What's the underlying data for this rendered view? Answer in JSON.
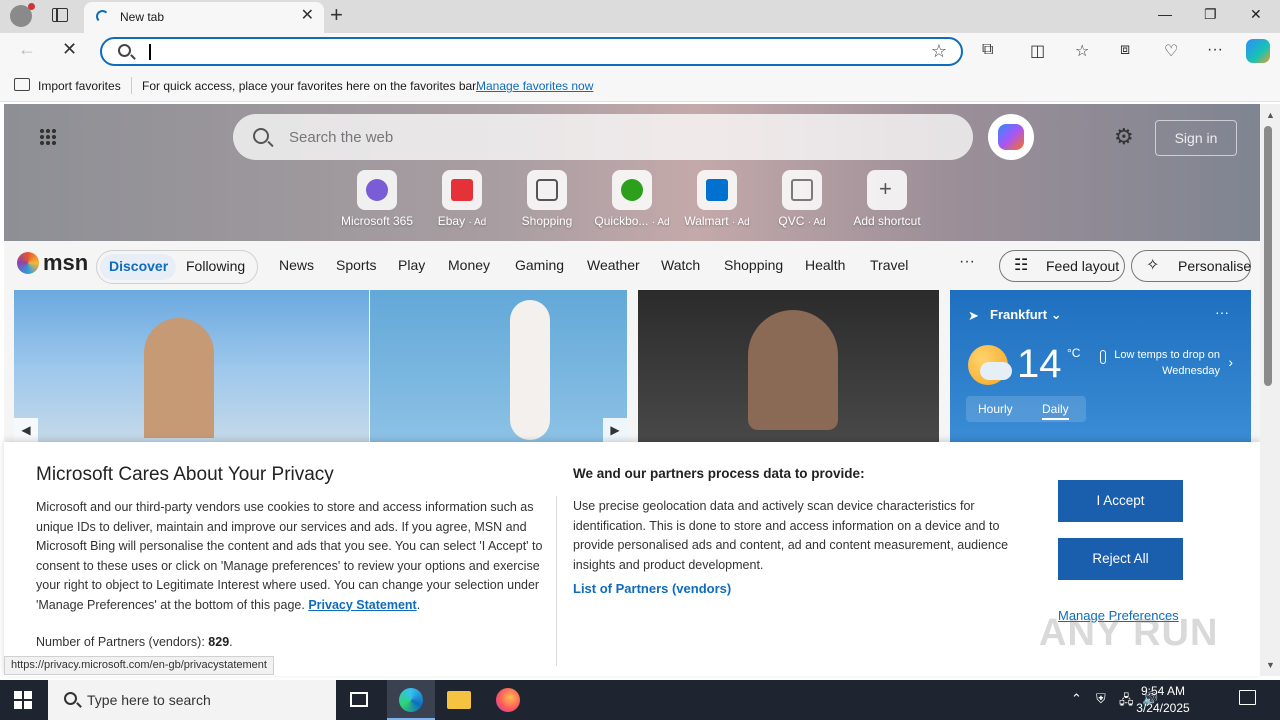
{
  "browser": {
    "tab_title": "New tab",
    "address_value": "",
    "favorites_import": "Import favorites",
    "favorites_hint": "For quick access, place your favorites here on the favorites bar.",
    "favorites_link": "Manage favorites now",
    "accent_color": "#0f6cbd"
  },
  "msn": {
    "search_placeholder": "Search the web",
    "sign_in": "Sign in",
    "shortcuts": [
      {
        "label": "Microsoft 365",
        "ad": "",
        "icon": "microsoft-365-icon",
        "color": "#7a5cd6"
      },
      {
        "label": "Ebay",
        "ad": "· Ad",
        "icon": "ebay-icon",
        "color": "#e53238"
      },
      {
        "label": "Shopping",
        "ad": "",
        "icon": "shopping-tag-icon",
        "color": "#555555"
      },
      {
        "label": "Quickbo...",
        "ad": "· Ad",
        "icon": "quickbooks-icon",
        "color": "#2ca01c"
      },
      {
        "label": "Walmart",
        "ad": "· Ad",
        "icon": "walmart-icon",
        "color": "#0071ce"
      },
      {
        "label": "QVC",
        "ad": "· Ad",
        "icon": "qvc-icon",
        "color": "#7a7a7a"
      },
      {
        "label": "Add shortcut",
        "ad": "",
        "icon": "plus-icon",
        "color": "#555555"
      }
    ],
    "logo": "msn",
    "feed_tabs": [
      "Discover",
      "Following"
    ],
    "nav": [
      "News",
      "Sports",
      "Play",
      "Money",
      "Gaming",
      "Weather",
      "Watch",
      "Shopping",
      "Health",
      "Travel"
    ],
    "more": "···",
    "feed_layout": "Feed layout",
    "personalise": "Personalise",
    "weather": {
      "location": "Frankfurt",
      "temp": "14",
      "unit": "°C",
      "note": "Low temps to drop on Wednesday",
      "tabs": [
        "Hourly",
        "Daily"
      ]
    }
  },
  "privacy": {
    "title": "Microsoft Cares About Your Privacy",
    "body": "Microsoft and our third-party vendors use cookies to store and access information such as unique IDs to deliver, maintain and improve our services and ads. If you agree, MSN and Microsoft Bing will personalise the content and ads that you see. You can select 'I Accept' to consent to these uses or click on 'Manage preferences' to review your options and exercise your right to object to Legitimate Interest where used.  You can change your selection under 'Manage Preferences' at the bottom of this page.",
    "privacy_link": "Privacy Statement",
    "partners_label": "Number of Partners (vendors):",
    "partners_count": "829",
    "right_title": "We and our partners process data to provide:",
    "right_body": "Use precise geolocation data and actively scan device characteristics for identification. This is done to store and access information on a device and to provide personalised ads and content, ad and content measurement, audience insights and product development.",
    "partners_list": "List of Partners (vendors)",
    "accept": "I Accept",
    "reject": "Reject All",
    "manage": "Manage Preferences",
    "button_color": "#1a5fad"
  },
  "status_url": "https://privacy.microsoft.com/en-gb/privacystatement",
  "watermark": "ANY RUN",
  "taskbar": {
    "search_placeholder": "Type here to search",
    "time": "9:54 AM",
    "date": "3/24/2025"
  }
}
